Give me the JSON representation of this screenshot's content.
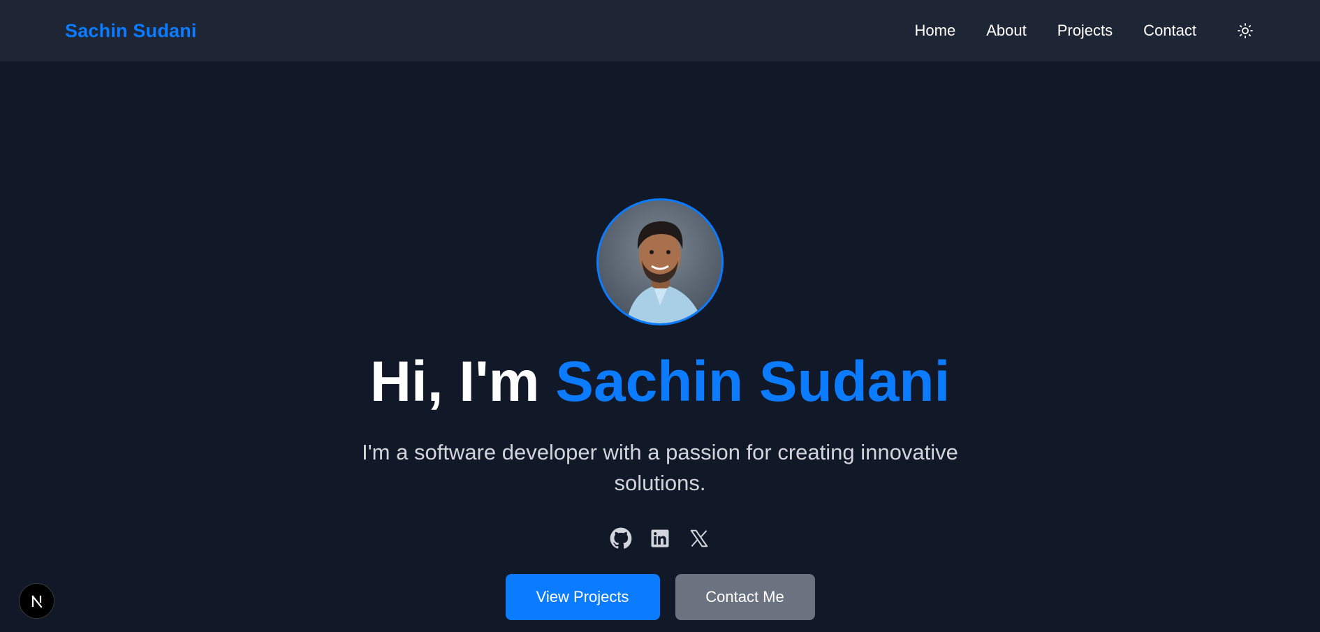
{
  "header": {
    "brand": "Sachin Sudani",
    "nav": [
      {
        "label": "Home"
      },
      {
        "label": "About"
      },
      {
        "label": "Projects"
      },
      {
        "label": "Contact"
      }
    ],
    "theme_icon": "sun-icon"
  },
  "hero": {
    "greeting": "Hi, I'm ",
    "name": "Sachin Sudani",
    "tagline": "I'm a software developer with a passion for creating innovative solutions.",
    "socials": [
      {
        "icon": "github-icon"
      },
      {
        "icon": "linkedin-icon"
      },
      {
        "icon": "x-icon"
      }
    ],
    "primary_button": "View Projects",
    "secondary_button": "Contact Me"
  },
  "colors": {
    "background": "#111827",
    "navbar": "#1e2635",
    "accent": "#0b7bff",
    "secondary_button": "#6b7280"
  },
  "dev_badge": {
    "icon": "nextjs-icon"
  }
}
